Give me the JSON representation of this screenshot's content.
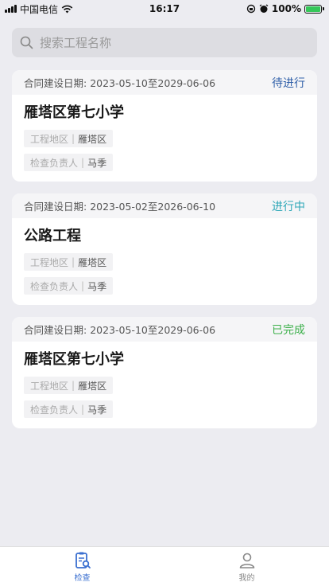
{
  "status_bar": {
    "carrier": "中国电信",
    "time": "16:17",
    "battery": "100%"
  },
  "search": {
    "placeholder": "搜索工程名称"
  },
  "projects": [
    {
      "date_label": "合同建设日期:",
      "start": "2023-05-10",
      "to": "至",
      "end": "2029-06-06",
      "status": "待进行",
      "status_color": "#2f5fa8",
      "title": "雁塔区第七小学",
      "region_key": "工程地区",
      "region_value": "雁塔区",
      "person_key": "检查负责人",
      "person_value": "马季"
    },
    {
      "date_label": "合同建设日期:",
      "start": "2023-05-02",
      "to": "至",
      "end": "2026-06-10",
      "status": "进行中",
      "status_color": "#2fa8b8",
      "title": "公路工程",
      "region_key": "工程地区",
      "region_value": "雁塔区",
      "person_key": "检查负责人",
      "person_value": "马季"
    },
    {
      "date_label": "合同建设日期:",
      "start": "2023-05-10",
      "to": "至",
      "end": "2029-06-06",
      "status": "已完成",
      "status_color": "#3cb04a",
      "title": "雁塔区第七小学",
      "region_key": "工程地区",
      "region_value": "雁塔区",
      "person_key": "检查负责人",
      "person_value": "马季"
    }
  ],
  "tabbar": {
    "tabs": [
      {
        "label": "检查",
        "icon": "clipboard-search-icon",
        "active": true
      },
      {
        "label": "我的",
        "icon": "user-icon",
        "active": false
      }
    ],
    "active_color": "#3a6fd0",
    "inactive_color": "#888888"
  }
}
